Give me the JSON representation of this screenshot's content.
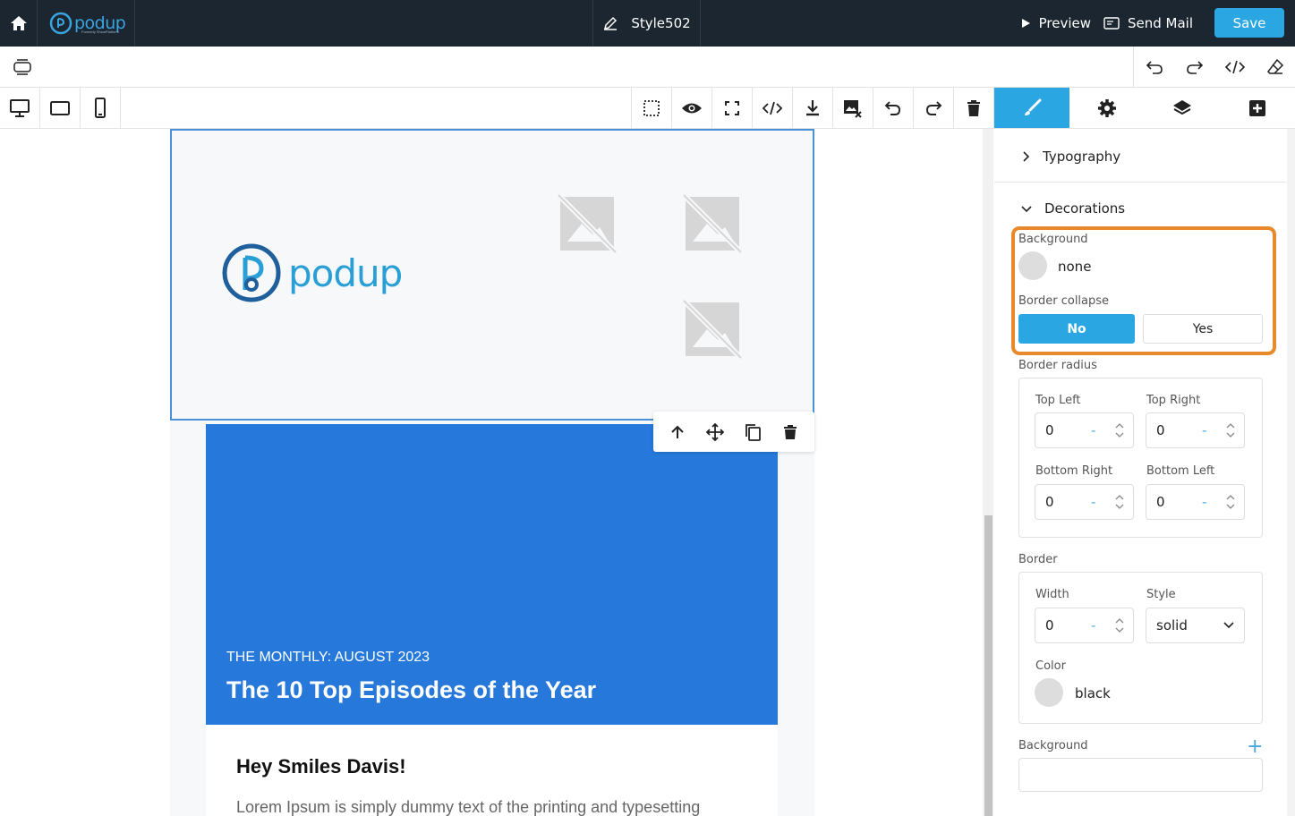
{
  "app": {
    "logo_text": "podup",
    "logo_subtext": "Formerly ShowPlatform",
    "template_name": "Style502",
    "preview_label": "Preview",
    "send_mail_label": "Send Mail",
    "save_label": "Save"
  },
  "email": {
    "logo_text": "podup",
    "hero_kicker": "THE MONTHLY: AUGUST 2023",
    "hero_title": "The 10 Top Episodes of the Year",
    "greeting": "Hey Smiles Davis!",
    "body_text": "Lorem Ipsum is simply dummy text of the printing and typesetting"
  },
  "panel": {
    "typography": "Typography",
    "decorations": "Decorations",
    "background_label": "Background",
    "background_value": "none",
    "border_collapse_label": "Border collapse",
    "no_label": "No",
    "yes_label": "Yes",
    "border_radius_label": "Border radius",
    "top_left_label": "Top Left",
    "top_left_value": "0",
    "top_right_label": "Top Right",
    "top_right_value": "0",
    "bottom_right_label": "Bottom Right",
    "bottom_right_value": "0",
    "bottom_left_label": "Bottom Left",
    "bottom_left_value": "0",
    "unit": "-",
    "border_label": "Border",
    "width_label": "Width",
    "width_value": "0",
    "style_label": "Style",
    "style_value": "solid",
    "color_label": "Color",
    "color_value": "black",
    "background2_label": "Background",
    "plus": "+"
  },
  "colors": {
    "topbar": "#1b2631",
    "accent": "#2aa7e2",
    "hero": "#2679da",
    "highlight": "#e8892c"
  }
}
